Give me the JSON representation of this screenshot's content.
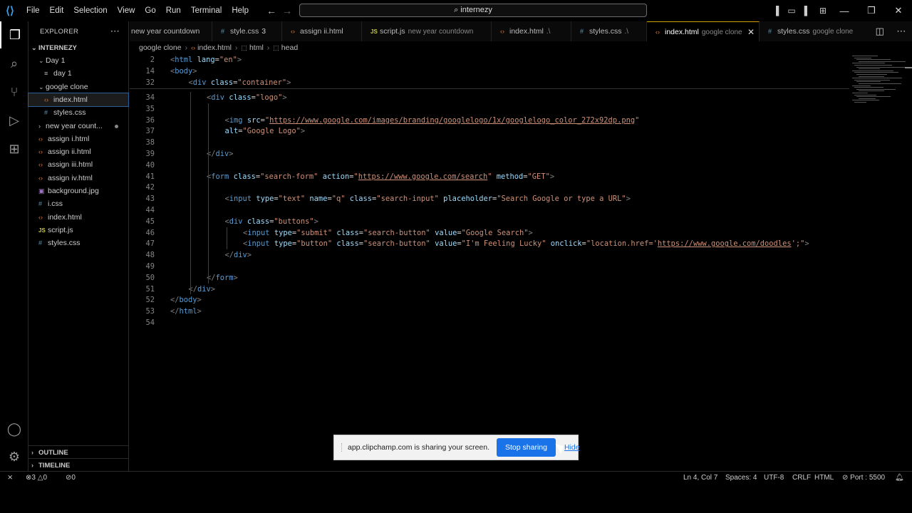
{
  "titlebar": {
    "menu": [
      "File",
      "Edit",
      "Selection",
      "View",
      "Go",
      "Run",
      "Terminal",
      "Help"
    ],
    "search": "internezy"
  },
  "sidebar": {
    "title": "EXPLORER",
    "root": "INTERNEZY",
    "items": [
      {
        "label": "Day 1",
        "type": "folder",
        "open": true
      },
      {
        "label": "day 1",
        "type": "txt"
      },
      {
        "label": "google clone",
        "type": "folder",
        "open": true
      },
      {
        "label": "index.html",
        "type": "html",
        "selected": true
      },
      {
        "label": "styles.css",
        "type": "css"
      },
      {
        "label": "new year count...",
        "type": "folder",
        "open": false
      },
      {
        "label": "assign i.html",
        "type": "html"
      },
      {
        "label": "assign ii.html",
        "type": "html"
      },
      {
        "label": "assign iii.html",
        "type": "html"
      },
      {
        "label": "assign iv.html",
        "type": "html"
      },
      {
        "label": "background.jpg",
        "type": "img"
      },
      {
        "label": "i.css",
        "type": "css"
      },
      {
        "label": "index.html",
        "type": "html"
      },
      {
        "label": "script.js",
        "type": "js"
      },
      {
        "label": "styles.css",
        "type": "css"
      }
    ],
    "outline": "OUTLINE",
    "timeline": "TIMELINE"
  },
  "tabs": [
    {
      "label": "new year countdown",
      "desc": "",
      "icon": "none"
    },
    {
      "label": "style.css",
      "desc": "3",
      "icon": "css"
    },
    {
      "label": "assign ii.html",
      "desc": "",
      "icon": "html"
    },
    {
      "label": "script.js",
      "desc": "new year countdown",
      "icon": "js"
    },
    {
      "label": "index.html",
      "desc": ".\\",
      "icon": "html"
    },
    {
      "label": "styles.css",
      "desc": ".\\",
      "icon": "css"
    },
    {
      "label": "index.html",
      "desc": "google clone",
      "icon": "html",
      "active": true
    },
    {
      "label": "styles.css",
      "desc": "google clone",
      "icon": "css"
    }
  ],
  "breadcrumb": [
    "google clone",
    "index.html",
    "html",
    "head"
  ],
  "editor": {
    "sticky": [
      {
        "num": "2",
        "indent": 0,
        "tokens": [
          [
            "tag",
            "<"
          ],
          [
            "name",
            "html"
          ],
          [
            "plain",
            " "
          ],
          [
            "attr",
            "lang"
          ],
          [
            "plain",
            "="
          ],
          [
            "val",
            "\"en\""
          ],
          [
            "tag",
            ">"
          ]
        ]
      },
      {
        "num": "14",
        "indent": 0,
        "tokens": [
          [
            "tag",
            "<"
          ],
          [
            "name",
            "body"
          ],
          [
            "tag",
            ">"
          ]
        ]
      },
      {
        "num": "32",
        "indent": 1,
        "tokens": [
          [
            "tag",
            "<"
          ],
          [
            "name",
            "div"
          ],
          [
            "plain",
            " "
          ],
          [
            "attr",
            "class"
          ],
          [
            "plain",
            "="
          ],
          [
            "val",
            "\"container\""
          ],
          [
            "tag",
            ">"
          ]
        ]
      }
    ],
    "lines": [
      {
        "num": "34",
        "indent": 2,
        "tokens": [
          [
            "tag",
            "<"
          ],
          [
            "name",
            "div"
          ],
          [
            "plain",
            " "
          ],
          [
            "attr",
            "class"
          ],
          [
            "plain",
            "="
          ],
          [
            "val",
            "\"logo\""
          ],
          [
            "tag",
            ">"
          ]
        ]
      },
      {
        "num": "35",
        "indent": 0,
        "tokens": []
      },
      {
        "num": "36",
        "indent": 3,
        "tokens": [
          [
            "tag",
            "<"
          ],
          [
            "name",
            "img"
          ],
          [
            "plain",
            " "
          ],
          [
            "attr",
            "src"
          ],
          [
            "plain",
            "="
          ],
          [
            "val",
            "\""
          ],
          [
            "url",
            "https://www.google.com/images/branding/googlelogo/1x/googlelogo_color_272x92dp.png"
          ],
          [
            "val",
            "\""
          ]
        ]
      },
      {
        "num": "37",
        "indent": 3,
        "tokens": [
          [
            "attr",
            "alt"
          ],
          [
            "plain",
            "="
          ],
          [
            "val",
            "\"Google Logo\""
          ],
          [
            "tag",
            ">"
          ]
        ]
      },
      {
        "num": "38",
        "indent": 0,
        "tokens": []
      },
      {
        "num": "39",
        "indent": 2,
        "tokens": [
          [
            "tag",
            "</"
          ],
          [
            "name",
            "div"
          ],
          [
            "tag",
            ">"
          ]
        ]
      },
      {
        "num": "40",
        "indent": 0,
        "tokens": []
      },
      {
        "num": "41",
        "indent": 2,
        "tokens": [
          [
            "tag",
            "<"
          ],
          [
            "name",
            "form"
          ],
          [
            "plain",
            " "
          ],
          [
            "attr",
            "class"
          ],
          [
            "plain",
            "="
          ],
          [
            "val",
            "\"search-form\""
          ],
          [
            "plain",
            " "
          ],
          [
            "attr",
            "action"
          ],
          [
            "plain",
            "="
          ],
          [
            "val",
            "\""
          ],
          [
            "url",
            "https://www.google.com/search"
          ],
          [
            "val",
            "\""
          ],
          [
            "plain",
            " "
          ],
          [
            "attr",
            "method"
          ],
          [
            "plain",
            "="
          ],
          [
            "val",
            "\"GET\""
          ],
          [
            "tag",
            ">"
          ]
        ]
      },
      {
        "num": "42",
        "indent": 0,
        "tokens": []
      },
      {
        "num": "43",
        "indent": 3,
        "tokens": [
          [
            "tag",
            "<"
          ],
          [
            "name",
            "input"
          ],
          [
            "plain",
            " "
          ],
          [
            "attr",
            "type"
          ],
          [
            "plain",
            "="
          ],
          [
            "val",
            "\"text\""
          ],
          [
            "plain",
            " "
          ],
          [
            "attr",
            "name"
          ],
          [
            "plain",
            "="
          ],
          [
            "val",
            "\"q\""
          ],
          [
            "plain",
            " "
          ],
          [
            "attr",
            "class"
          ],
          [
            "plain",
            "="
          ],
          [
            "val",
            "\"search-input\""
          ],
          [
            "plain",
            " "
          ],
          [
            "attr",
            "placeholder"
          ],
          [
            "plain",
            "="
          ],
          [
            "val",
            "\"Search Google or type a URL\""
          ],
          [
            "tag",
            ">"
          ]
        ]
      },
      {
        "num": "44",
        "indent": 0,
        "tokens": []
      },
      {
        "num": "45",
        "indent": 3,
        "tokens": [
          [
            "tag",
            "<"
          ],
          [
            "name",
            "div"
          ],
          [
            "plain",
            " "
          ],
          [
            "attr",
            "class"
          ],
          [
            "plain",
            "="
          ],
          [
            "val",
            "\"buttons\""
          ],
          [
            "tag",
            ">"
          ]
        ]
      },
      {
        "num": "46",
        "indent": 4,
        "tokens": [
          [
            "tag",
            "<"
          ],
          [
            "name",
            "input"
          ],
          [
            "plain",
            " "
          ],
          [
            "attr",
            "type"
          ],
          [
            "plain",
            "="
          ],
          [
            "val",
            "\"submit\""
          ],
          [
            "plain",
            " "
          ],
          [
            "attr",
            "class"
          ],
          [
            "plain",
            "="
          ],
          [
            "val",
            "\"search-button\""
          ],
          [
            "plain",
            " "
          ],
          [
            "attr",
            "value"
          ],
          [
            "plain",
            "="
          ],
          [
            "val",
            "\"Google Search\""
          ],
          [
            "tag",
            ">"
          ]
        ]
      },
      {
        "num": "47",
        "indent": 4,
        "tokens": [
          [
            "tag",
            "<"
          ],
          [
            "name",
            "input"
          ],
          [
            "plain",
            " "
          ],
          [
            "attr",
            "type"
          ],
          [
            "plain",
            "="
          ],
          [
            "val",
            "\"button\""
          ],
          [
            "plain",
            " "
          ],
          [
            "attr",
            "class"
          ],
          [
            "plain",
            "="
          ],
          [
            "val",
            "\"search-button\""
          ],
          [
            "plain",
            " "
          ],
          [
            "attr",
            "value"
          ],
          [
            "plain",
            "="
          ],
          [
            "val",
            "\"I'm Feeling Lucky\""
          ],
          [
            "plain",
            " "
          ],
          [
            "attr",
            "onclick"
          ],
          [
            "plain",
            "="
          ],
          [
            "val",
            "\"location.href='"
          ],
          [
            "url",
            "https://www.google.com/doodles"
          ],
          [
            "val",
            "';\""
          ],
          [
            "tag",
            ">"
          ]
        ]
      },
      {
        "num": "48",
        "indent": 3,
        "tokens": [
          [
            "tag",
            "</"
          ],
          [
            "name",
            "div"
          ],
          [
            "tag",
            ">"
          ]
        ]
      },
      {
        "num": "49",
        "indent": 0,
        "tokens": []
      },
      {
        "num": "50",
        "indent": 2,
        "tokens": [
          [
            "tag",
            "</"
          ],
          [
            "name",
            "form"
          ],
          [
            "tag",
            ">"
          ]
        ]
      },
      {
        "num": "51",
        "indent": 1,
        "tokens": [
          [
            "tag",
            "</"
          ],
          [
            "name",
            "div"
          ],
          [
            "tag",
            ">"
          ]
        ]
      },
      {
        "num": "52",
        "indent": 0,
        "tokens": [
          [
            "tag",
            "</"
          ],
          [
            "name",
            "body"
          ],
          [
            "tag",
            ">"
          ]
        ]
      },
      {
        "num": "53",
        "indent": 0,
        "tokens": [
          [
            "tag",
            "</"
          ],
          [
            "name",
            "html"
          ],
          [
            "tag",
            ">"
          ]
        ]
      },
      {
        "num": "54",
        "indent": 0,
        "tokens": []
      }
    ]
  },
  "statusbar": {
    "errors": "3",
    "warnings": "0",
    "ports": "0",
    "position": "Ln 4, Col 7",
    "spaces": "Spaces: 4",
    "encoding": "UTF-8",
    "eol": "CRLF",
    "language": "HTML",
    "port": "Port : 5500"
  },
  "share_banner": {
    "text": "app.clipchamp.com is sharing your screen.",
    "stop": "Stop sharing",
    "hide": "Hide"
  },
  "colors": {
    "accent": "#1a73e8",
    "tag": "#569cd6",
    "attr": "#9cdcfe",
    "string": "#ce9178"
  }
}
